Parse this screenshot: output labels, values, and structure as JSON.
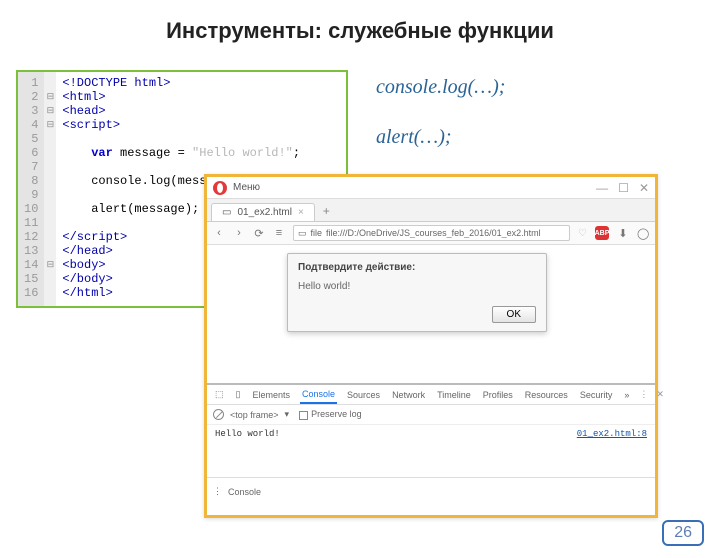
{
  "slide": {
    "title": "Инструменты: служебные функции",
    "page_number": "26"
  },
  "callouts": {
    "c1": "console.log(…);",
    "c2": "alert(…);"
  },
  "code": {
    "lines": [
      {
        "n": "1",
        "fold": "",
        "html": "<span class='tag'>&lt;!DOCTYPE html&gt;</span>"
      },
      {
        "n": "2",
        "fold": "⊟",
        "html": "<span class='tag'>&lt;html&gt;</span>"
      },
      {
        "n": "3",
        "fold": "⊟",
        "html": "<span class='tag'>&lt;head&gt;</span>"
      },
      {
        "n": "4",
        "fold": "⊟",
        "html": "<span class='tag'>&lt;script&gt;</span>"
      },
      {
        "n": "5",
        "fold": "",
        "html": ""
      },
      {
        "n": "6",
        "fold": "",
        "html": "    <span class='kw'>var</span> message = <span class='str'>\"Hello world!\"</span>;"
      },
      {
        "n": "7",
        "fold": "",
        "html": ""
      },
      {
        "n": "8",
        "fold": "",
        "html": "    console.log(message);"
      },
      {
        "n": "9",
        "fold": "",
        "html": ""
      },
      {
        "n": "10",
        "fold": "",
        "html": "    alert(message);"
      },
      {
        "n": "11",
        "fold": "",
        "html": ""
      },
      {
        "n": "12",
        "fold": "",
        "html": "<span class='tag'>&lt;/script&gt;</span>"
      },
      {
        "n": "13",
        "fold": "",
        "html": "<span class='tag'>&lt;/head&gt;</span>"
      },
      {
        "n": "14",
        "fold": "⊟",
        "html": "<span class='tag'>&lt;body&gt;</span>"
      },
      {
        "n": "15",
        "fold": "",
        "html": "<span class='tag'>&lt;/body&gt;</span>"
      },
      {
        "n": "16",
        "fold": "",
        "html": "<span class='tag'>&lt;/html&gt;</span>"
      }
    ]
  },
  "browser": {
    "menu_label": "Меню",
    "tab_title": "01_ex2.html",
    "url": "file:///D:/OneDrive/JS_courses_feb_2016/01_ex2.html",
    "toolbar_file_label": "file",
    "abp_label": "ABP",
    "alert": {
      "title": "Подтвердите действие:",
      "message": "Hello world!",
      "ok": "OK"
    },
    "devtools": {
      "tabs": [
        "Elements",
        "Console",
        "Sources",
        "Network",
        "Timeline",
        "Profiles",
        "Resources",
        "Security"
      ],
      "active_tab": "Console",
      "frame_selector": "<top frame>",
      "preserve_log": "Preserve log",
      "log_msg": "Hello world!",
      "log_src": "01_ex2.html:8",
      "prompt_label": "Console"
    }
  }
}
